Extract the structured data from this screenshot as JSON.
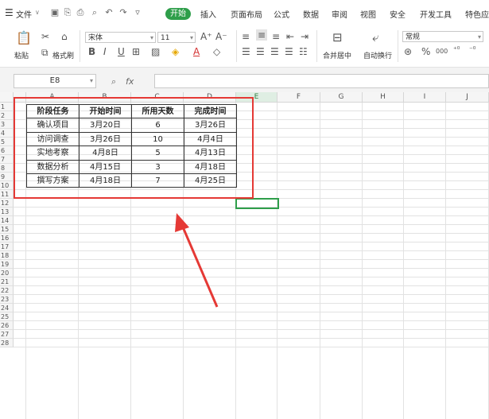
{
  "menu": {
    "file_label": "文件",
    "start_label": "开始",
    "tabs": [
      "插入",
      "页面布局",
      "公式",
      "数据",
      "审阅",
      "视图",
      "安全",
      "开发工具",
      "特色应"
    ]
  },
  "toolbar": {
    "paste_label": "粘贴",
    "format_painter_label": "格式刷",
    "font_name": "宋体",
    "font_size": "11",
    "bold": "B",
    "italic": "I",
    "underline": "U",
    "merge_center_label": "合并居中",
    "wrap_text_label": "自动换行",
    "number_format": "常规",
    "percent": "%",
    "thousands": "000"
  },
  "formula_bar": {
    "name_box": "E8",
    "fx_label": "fx",
    "content": ""
  },
  "sheet": {
    "columns": [
      "A",
      "B",
      "C",
      "D",
      "E",
      "F",
      "G",
      "H",
      "I",
      "J"
    ],
    "selected_column": "E",
    "selected_cell": "E8",
    "rows": [
      "1",
      "2",
      "3",
      "4",
      "5",
      "6",
      "7",
      "8",
      "9",
      "10",
      "11",
      "12",
      "13",
      "14",
      "15",
      "16",
      "17",
      "18",
      "19",
      "20",
      "21",
      "22",
      "23",
      "24",
      "25",
      "26",
      "27",
      "28"
    ],
    "table_header": [
      "阶段任务",
      "开始时间",
      "所用天数",
      "完成时间"
    ],
    "table_rows": [
      [
        "确认项目",
        "3月20日",
        "6",
        "3月26日"
      ],
      [
        "访问调查",
        "3月26日",
        "10",
        "4月4日"
      ],
      [
        "实地考察",
        "4月8日",
        "5",
        "4月13日"
      ],
      [
        "数据分析",
        "4月15日",
        "3",
        "4月18日"
      ],
      [
        "撰写方案",
        "4月18日",
        "7",
        "4月25日"
      ]
    ]
  },
  "annotation": {
    "highlight_color": "#e53935",
    "selection_color": "#2e9e4a"
  }
}
